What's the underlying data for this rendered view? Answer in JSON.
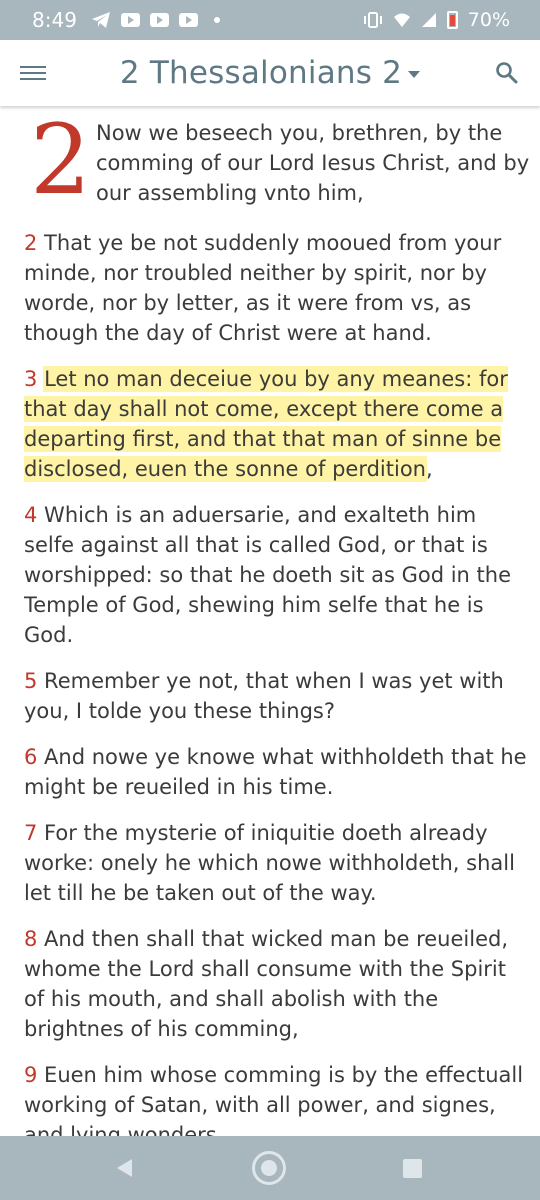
{
  "status_bar": {
    "time": "8:49",
    "battery": "70%",
    "icons": [
      "telegram-icon",
      "youtube-icon",
      "youtube-icon",
      "youtube-icon",
      "notification-dot-icon",
      "vibrate-icon",
      "wifi-icon",
      "signal-icon",
      "battery-icon"
    ]
  },
  "app_bar": {
    "title": "2 Thessalonians 2",
    "menu_icon": "hamburger-menu-icon",
    "dropdown_icon": "caret-down-icon",
    "search_icon": "search-icon"
  },
  "colors": {
    "verse_number": "#c0392b",
    "highlight": "#fff3a6",
    "title": "#5f7984",
    "system_bar": "#a8b6bd"
  },
  "chapter": {
    "number": "2",
    "verse1": "Now we beseech you, brethren, by the comming of our Lord Iesus Christ, and by our assembling vnto him,",
    "verses": [
      {
        "num": "2",
        "text": " That ye be not suddenly mooued from your minde, nor troubled neither by spirit, nor by worde, nor by letter, as it were from vs, as though the day of Christ were at hand."
      },
      {
        "num": "3",
        "text": "Let no man deceiue you by any meanes: for that day shall not come, except there come a departing first, and that that man of sinne be disclosed, euen the sonne of perdition",
        "tail": ",",
        "highlighted": true
      },
      {
        "num": "4",
        "text": " Which is an aduersarie, and exalteth him selfe against all that is called God, or that is worshipped: so that he doeth sit as God in the Temple of God, shewing him selfe that he is God."
      },
      {
        "num": "5",
        "text": " Remember ye not, that when I was yet with you, I tolde you these things?"
      },
      {
        "num": "6",
        "text": " And nowe ye knowe what withholdeth that he might be reueiled in his time."
      },
      {
        "num": "7",
        "text": " For the mysterie of iniquitie doeth already worke: onely he which nowe withholdeth, shall let till he be taken out of the way."
      },
      {
        "num": "8",
        "text": " And then shall that wicked man be reueiled, whome the Lord shall consume with the Spirit of his mouth, and shall abolish with the brightnes of his comming,"
      },
      {
        "num": "9",
        "text": " Euen him whose comming is by the effectuall working of Satan, with all power, and signes, and lying wonders,"
      }
    ]
  },
  "nav_bar": {
    "back_icon": "back-triangle-icon",
    "home_icon": "home-circle-icon",
    "recents_icon": "recents-square-icon"
  }
}
